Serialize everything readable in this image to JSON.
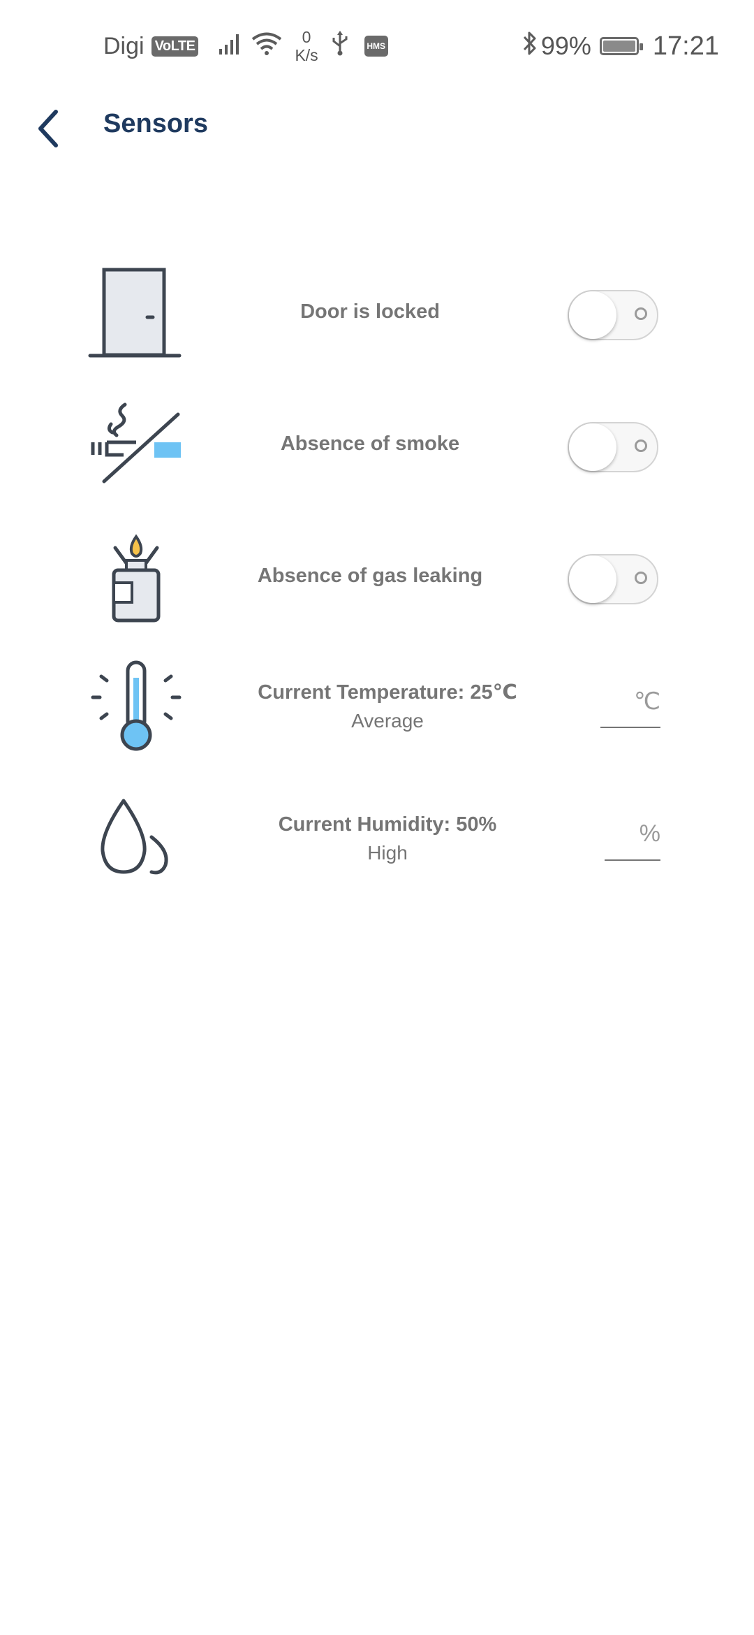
{
  "status_bar": {
    "carrier": "Digi",
    "volte": "VoLTE",
    "speed_value": "0",
    "speed_unit": "K/s",
    "hms": "HMS",
    "battery_percent": "99%",
    "time": "17:21"
  },
  "app_bar": {
    "title": "Sensors"
  },
  "sensors": [
    {
      "label": "Door is locked",
      "toggle_on": false
    },
    {
      "label": "Absence of smoke",
      "toggle_on": false
    },
    {
      "label": "Absence of gas leaking",
      "toggle_on": false
    },
    {
      "label": "Current Temperature: 25℃",
      "sublabel": "Average",
      "unit_placeholder": "℃"
    },
    {
      "label": "Current Humidity: 50%",
      "sublabel": "High",
      "unit_placeholder": "%"
    }
  ],
  "colors": {
    "title": "#1f3a5f",
    "label": "#757575",
    "accent_blue": "#6ec3f4",
    "icon_stroke": "#3d4550"
  }
}
